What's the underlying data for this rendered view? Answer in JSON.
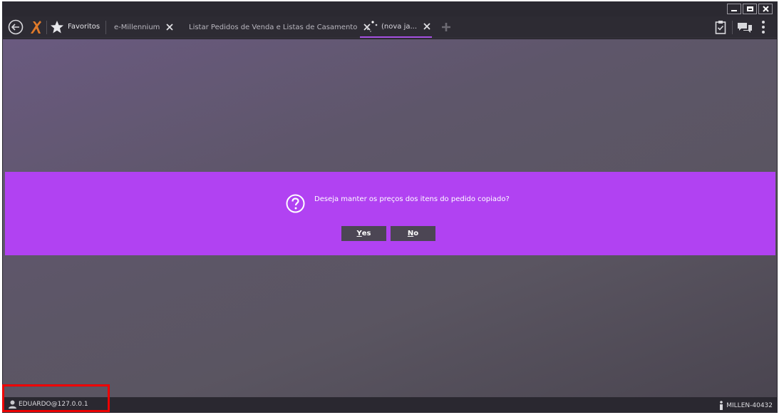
{
  "window": {
    "controls": [
      {
        "name": "minimize-icon"
      },
      {
        "name": "maximize-icon"
      },
      {
        "name": "close-icon"
      }
    ]
  },
  "toolbar": {
    "favorites_label": "Favoritos",
    "tabs": [
      {
        "label": "e-Millennium",
        "active": false
      },
      {
        "label": "Listar Pedidos de Venda e Listas de Casamento",
        "active": false
      },
      {
        "label": "(nova ja...",
        "active": true
      }
    ],
    "right_icons": [
      "clipboard-check-icon",
      "chat-icon",
      "more-vertical-icon"
    ]
  },
  "dialog": {
    "message": "Deseja manter os preços dos itens do pedido copiado?",
    "icon": "question-icon",
    "buttons": [
      {
        "accel": "Y",
        "rest": "es"
      },
      {
        "accel": "N",
        "rest": "o"
      }
    ]
  },
  "status": {
    "user": "EDUARDO@127.0.0.1",
    "server": "MILLEN-40432"
  },
  "colors": {
    "accent": "#b142f2",
    "tab_active_underline": "#a44ee0",
    "highlight": "#ee0000"
  }
}
